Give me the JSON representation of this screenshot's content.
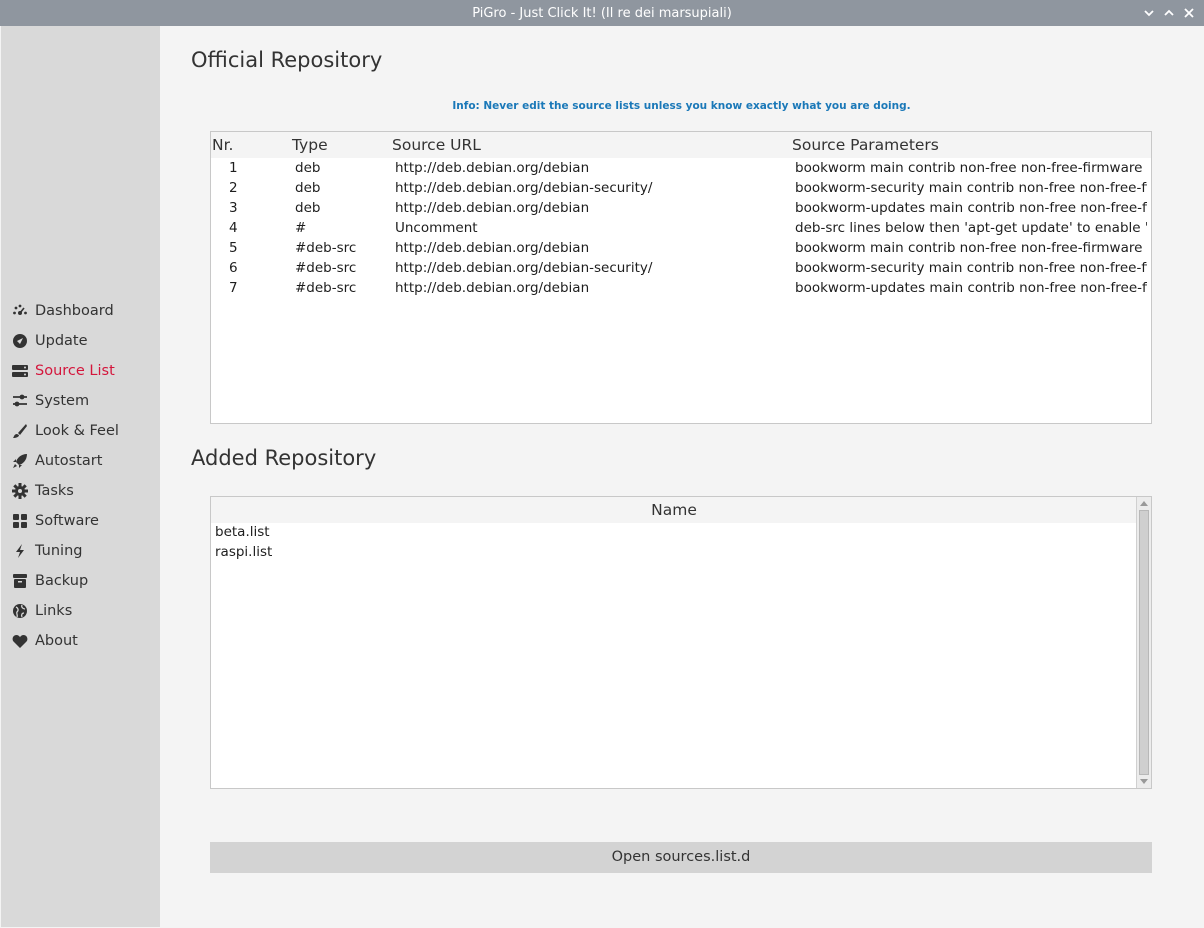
{
  "window": {
    "title": "PiGro - Just Click It! (Il re dei marsupiali)"
  },
  "sidebar": {
    "items": [
      {
        "label": "Dashboard",
        "icon": "dashboard-icon"
      },
      {
        "label": "Update",
        "icon": "update-icon"
      },
      {
        "label": "Source List",
        "icon": "server-icon",
        "active": true
      },
      {
        "label": "System",
        "icon": "sliders-icon"
      },
      {
        "label": "Look & Feel",
        "icon": "brush-icon"
      },
      {
        "label": "Autostart",
        "icon": "rocket-icon"
      },
      {
        "label": "Tasks",
        "icon": "gear-icon"
      },
      {
        "label": "Software",
        "icon": "apps-icon"
      },
      {
        "label": "Tuning",
        "icon": "bolt-icon"
      },
      {
        "label": "Backup",
        "icon": "archive-icon"
      },
      {
        "label": "Links",
        "icon": "globe-icon"
      },
      {
        "label": "About",
        "icon": "heart-icon"
      }
    ],
    "active_color": "#d4163c"
  },
  "official": {
    "heading": "Official Repository",
    "info": "Info: Never edit the source lists unless you know exactly what you are doing.",
    "columns": [
      "Nr.",
      "Type",
      "Source URL",
      "Source Parameters"
    ],
    "rows": [
      [
        "1",
        "deb",
        "http://deb.debian.org/debian",
        "bookworm main contrib non-free non-free-firmware"
      ],
      [
        "2",
        "deb",
        "http://deb.debian.org/debian-security/",
        "bookworm-security main contrib non-free non-free-firm"
      ],
      [
        "3",
        "deb",
        "http://deb.debian.org/debian",
        "bookworm-updates main contrib non-free non-free-firm"
      ],
      [
        "4",
        "#",
        "Uncomment",
        "deb-src lines below then 'apt-get update' to enable 'apt-"
      ],
      [
        "5",
        "#deb-src",
        "http://deb.debian.org/debian",
        "bookworm main contrib non-free non-free-firmware"
      ],
      [
        "6",
        "#deb-src",
        "http://deb.debian.org/debian-security/",
        "bookworm-security main contrib non-free non-free-firm"
      ],
      [
        "7",
        "#deb-src",
        "http://deb.debian.org/debian",
        "bookworm-updates main contrib non-free non-free-firm"
      ]
    ]
  },
  "added": {
    "heading": "Added Repository",
    "column": "Name",
    "rows": [
      "beta.list",
      "raspi.list"
    ]
  },
  "open_button": "Open sources.list.d"
}
